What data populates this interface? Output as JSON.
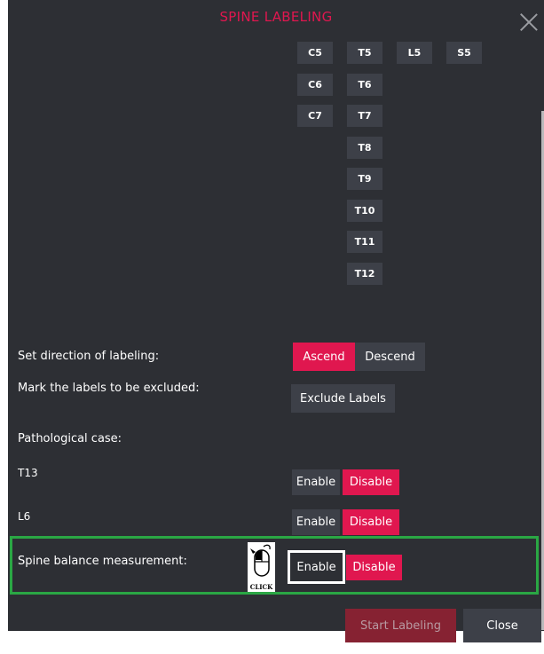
{
  "dialog": {
    "title": "SPINE LABELING"
  },
  "vertebrae": {
    "cervical": [
      "C5",
      "C6",
      "C7"
    ],
    "thoracic": [
      "T5",
      "T6",
      "T7",
      "T8",
      "T9",
      "T10",
      "T11",
      "T12"
    ],
    "lumbar": [
      "L5"
    ],
    "sacral": [
      "S5"
    ]
  },
  "direction": {
    "label": "Set direction of labeling:",
    "ascend": "Ascend",
    "descend": "Descend",
    "selected": "Ascend"
  },
  "exclude": {
    "label": "Mark the labels to be excluded:",
    "button": "Exclude Labels"
  },
  "pathological": {
    "label": "Pathological case:"
  },
  "t13": {
    "label": "T13",
    "enable": "Enable",
    "disable": "Disable",
    "selected": "Disable"
  },
  "l6": {
    "label": "L6",
    "enable": "Enable",
    "disable": "Disable",
    "selected": "Disable"
  },
  "spine_balance": {
    "label": "Spine balance measurement:",
    "enable": "Enable",
    "disable": "Disable",
    "selected": "Disable"
  },
  "click_hint": {
    "caption": "CLICK",
    "icon": "mouse-icon"
  },
  "footer": {
    "start": "Start Labeling",
    "close": "Close"
  },
  "colors": {
    "accent": "#e0174f",
    "background": "#2d2f34",
    "button": "#3d4048",
    "highlight": "#2aa744"
  }
}
